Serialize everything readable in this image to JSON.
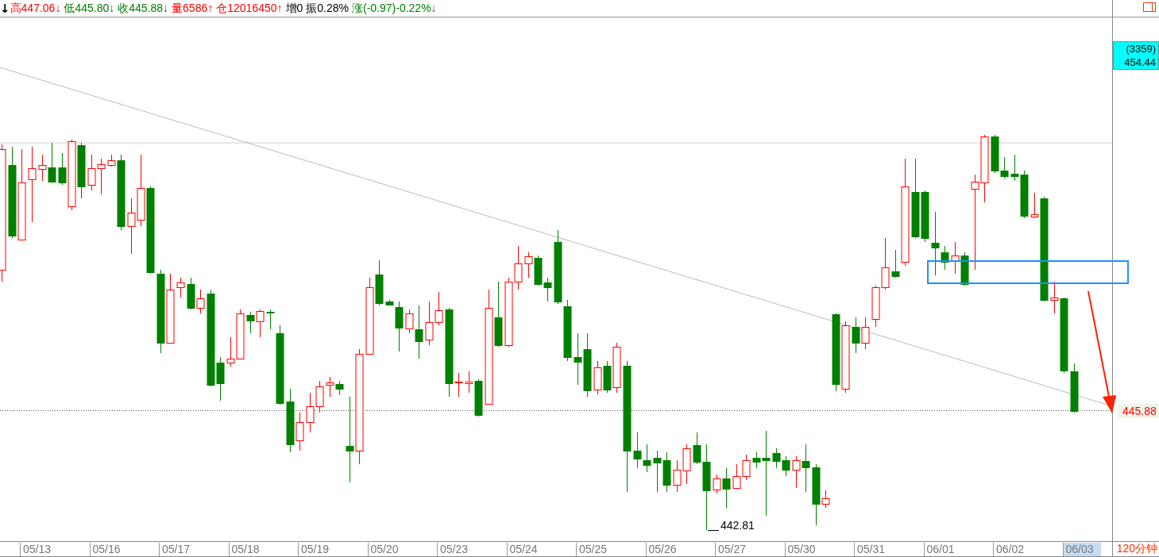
{
  "quote_bar": [
    {
      "text": "↓",
      "color": "#000000"
    },
    {
      "text": "高447.06↓",
      "color": "#ff0000"
    },
    {
      "text": "低445.80↓",
      "color": "#008000"
    },
    {
      "text": "收445.88↓",
      "color": "#008000"
    },
    {
      "text": "量6586↑",
      "color": "#ff0000"
    },
    {
      "text": "仓12016450↑",
      "color": "#ff0000"
    },
    {
      "text": "增0",
      "color": "#000000"
    },
    {
      "text": "振0.28%",
      "color": "#000000"
    },
    {
      "text": "涨(-0.97)-0.22%↓",
      "color": "#008000"
    }
  ],
  "chart": {
    "low_marker": "442.81",
    "last_price": "445.88",
    "cursor_box": {
      "count": "(3359)",
      "price": "454.44"
    },
    "dates": [
      {
        "label": "05/13",
        "selected": false
      },
      {
        "label": "05/16",
        "selected": false
      },
      {
        "label": "05/17",
        "selected": false
      },
      {
        "label": "05/18",
        "selected": false
      },
      {
        "label": "05/19",
        "selected": false
      },
      {
        "label": "05/20",
        "selected": false
      },
      {
        "label": "05/23",
        "selected": false
      },
      {
        "label": "05/24",
        "selected": false
      },
      {
        "label": "05/25",
        "selected": false
      },
      {
        "label": "05/26",
        "selected": false
      },
      {
        "label": "05/27",
        "selected": false
      },
      {
        "label": "05/30",
        "selected": false
      },
      {
        "label": "05/31",
        "selected": false
      },
      {
        "label": "06/01",
        "selected": false
      },
      {
        "label": "06/02",
        "selected": false
      },
      {
        "label": "06/03",
        "selected": true
      }
    ],
    "period": "120分钟"
  }
}
